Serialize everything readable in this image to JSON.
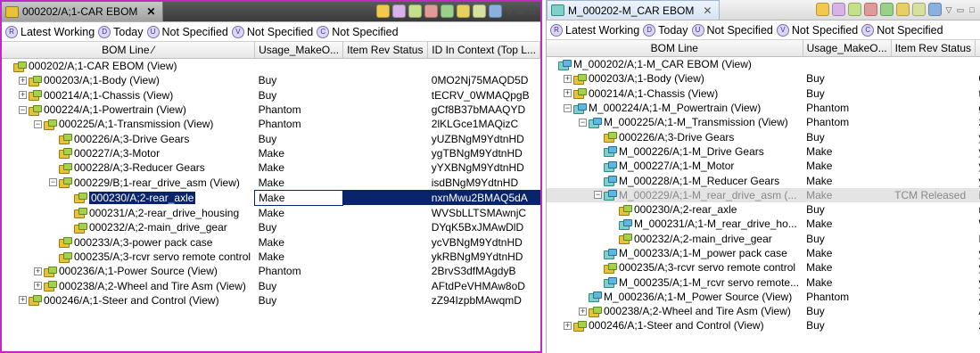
{
  "left": {
    "tab_title": "000202/A;1-CAR EBOM",
    "tab_close": "✕",
    "rev_rules": [
      "Latest Working",
      "Today",
      "Not Specified",
      "Not Specified",
      "Not Specified"
    ],
    "columns": [
      "BOM Line  ⁄",
      "Usage_MakeO...",
      "Item Rev Status",
      "ID In Context (Top L..."
    ],
    "rows": [
      {
        "indent": 0,
        "exp": "",
        "label": "000202/A;1-CAR EBOM (View)",
        "usage": "",
        "status": "",
        "id": ""
      },
      {
        "indent": 1,
        "exp": "+",
        "label": "000203/A;1-Body (View)",
        "usage": "Buy",
        "status": "",
        "id": "0MO2Nj75MAQD5D"
      },
      {
        "indent": 1,
        "exp": "+",
        "label": "000214/A;1-Chassis (View)",
        "usage": "Buy",
        "status": "",
        "id": "tECRV_0WMAQpgB"
      },
      {
        "indent": 1,
        "exp": "−",
        "label": "000224/A;1-Powertrain (View)",
        "usage": "Phantom",
        "status": "",
        "id": "gCf8B37bMAAQYD"
      },
      {
        "indent": 2,
        "exp": "−",
        "label": "000225/A;1-Transmission (View)",
        "usage": "Phantom",
        "status": "",
        "id": "2lKLGce1MAQizC"
      },
      {
        "indent": 3,
        "exp": "",
        "label": "000226/A;3-Drive Gears",
        "usage": "Buy",
        "status": "",
        "id": "yUZBNgM9YdtnHD"
      },
      {
        "indent": 3,
        "exp": "",
        "label": "000227/A;3-Motor",
        "usage": "Make",
        "status": "",
        "id": "ygTBNgM9YdtnHD"
      },
      {
        "indent": 3,
        "exp": "",
        "label": "000228/A;3-Reducer Gears",
        "usage": "Make",
        "status": "",
        "id": "yYXBNgM9YdtnHD"
      },
      {
        "indent": 3,
        "exp": "−",
        "label": "000229/B;1-rear_drive_asm (View)",
        "usage": "Make",
        "status": "",
        "id": "isdBNgM9YdtnHD"
      },
      {
        "indent": 4,
        "exp": "",
        "label": "000230/A;2-rear_axle",
        "usage": "Make",
        "status": "",
        "id": "nxnMwu2BMAQ5dA",
        "sel": true
      },
      {
        "indent": 4,
        "exp": "",
        "label": "000231/A;2-rear_drive_housing",
        "usage": "Make",
        "status": "",
        "id": "WVSbLLTSMAwnjC"
      },
      {
        "indent": 4,
        "exp": "",
        "label": "000232/A;2-main_drive_gear",
        "usage": "Buy",
        "status": "",
        "id": "DYqK5BxJMAwDlD"
      },
      {
        "indent": 3,
        "exp": "",
        "label": "000233/A;3-power pack case",
        "usage": "Make",
        "status": "",
        "id": "ycVBNgM9YdtnHD"
      },
      {
        "indent": 3,
        "exp": "",
        "label": "000235/A;3-rcvr servo remote control",
        "usage": "Make",
        "status": "",
        "id": "ykRBNgM9YdtnHD"
      },
      {
        "indent": 2,
        "exp": "+",
        "label": "000236/A;1-Power Source (View)",
        "usage": "Phantom",
        "status": "",
        "id": "2BrvS3dfMAgdyB"
      },
      {
        "indent": 2,
        "exp": "+",
        "label": "000238/A;2-Wheel and Tire Asm (View)",
        "usage": "Buy",
        "status": "",
        "id": "AFtdPeVHMAw8oD"
      },
      {
        "indent": 1,
        "exp": "+",
        "label": "000246/A;1-Steer and Control (View)",
        "usage": "Buy",
        "status": "",
        "id": "zZ94IzpbMAwqmD"
      }
    ]
  },
  "right": {
    "tab_title": "M_000202-M_CAR EBOM",
    "tab_close": "✕",
    "rev_rules": [
      "Latest Working",
      "Today",
      "Not Specified",
      "Not Specified",
      "Not Specified"
    ],
    "columns": [
      "BOM Line",
      "Usage_MakeO...",
      "Item Rev Status",
      "ID"
    ],
    "rows": [
      {
        "indent": 0,
        "exp": "",
        "label": "M_000202/A;1-M_CAR EBOM (View)",
        "usage": "",
        "status": "",
        "id": "",
        "teal": true
      },
      {
        "indent": 1,
        "exp": "+",
        "label": "000203/A;1-Body (View)",
        "usage": "Buy",
        "status": "",
        "id": "0M"
      },
      {
        "indent": 1,
        "exp": "+",
        "label": "000214/A;1-Chassis (View)",
        "usage": "Buy",
        "status": "",
        "id": "tE"
      },
      {
        "indent": 1,
        "exp": "−",
        "label": "M_000224/A;1-M_Powertrain (View)",
        "usage": "Phantom",
        "status": "",
        "id": "gC",
        "teal": true
      },
      {
        "indent": 2,
        "exp": "−",
        "label": "M_000225/A;1-M_Transmission (View)",
        "usage": "Phantom",
        "status": "",
        "id": "2l",
        "teal": true
      },
      {
        "indent": 3,
        "exp": "",
        "label": "000226/A;3-Drive Gears",
        "usage": "Buy",
        "status": "",
        "id": "yU"
      },
      {
        "indent": 3,
        "exp": "",
        "label": "M_000226/A;1-M_Drive Gears",
        "usage": "Make",
        "status": "",
        "id": "yU",
        "teal": true
      },
      {
        "indent": 3,
        "exp": "",
        "label": "M_000227/A;1-M_Motor",
        "usage": "Make",
        "status": "",
        "id": "yg",
        "teal": true
      },
      {
        "indent": 3,
        "exp": "",
        "label": "M_000228/A;1-M_Reducer Gears",
        "usage": "Make",
        "status": "",
        "id": "yY",
        "teal": true
      },
      {
        "indent": 3,
        "exp": "−",
        "label": "M_000229/A;1-M_rear_drive_asm (...",
        "usage": "Make",
        "status": "TCM Released",
        "id": "is",
        "teal": true,
        "grey": true
      },
      {
        "indent": 4,
        "exp": "",
        "label": "000230/A;2-rear_axle",
        "usage": "Buy",
        "status": "",
        "id": "nx"
      },
      {
        "indent": 4,
        "exp": "",
        "label": "M_000231/A;1-M_rear_drive_ho...",
        "usage": "Make",
        "status": "",
        "id": "W",
        "teal": true
      },
      {
        "indent": 4,
        "exp": "",
        "label": "000232/A;2-main_drive_gear",
        "usage": "Buy",
        "status": "",
        "id": "DY"
      },
      {
        "indent": 3,
        "exp": "",
        "label": "M_000233/A;1-M_power pack case",
        "usage": "Make",
        "status": "",
        "id": "yc",
        "teal": true
      },
      {
        "indent": 3,
        "exp": "",
        "label": "000235/A;3-rcvr servo remote control",
        "usage": "Make",
        "status": "",
        "id": "yk"
      },
      {
        "indent": 3,
        "exp": "",
        "label": "M_000235/A;1-M_rcvr servo remote...",
        "usage": "Make",
        "status": "",
        "id": "yk",
        "teal": true
      },
      {
        "indent": 2,
        "exp": "",
        "label": "M_000236/A;1-M_Power Source (View)",
        "usage": "Phantom",
        "status": "",
        "id": "2E",
        "teal": true
      },
      {
        "indent": 2,
        "exp": "+",
        "label": "000238/A;2-Wheel and Tire Asm (View)",
        "usage": "Buy",
        "status": "",
        "id": "Af"
      },
      {
        "indent": 1,
        "exp": "+",
        "label": "000246/A;1-Steer and Control (View)",
        "usage": "Buy",
        "status": "",
        "id": "zZ"
      }
    ]
  },
  "toolbar_icons": [
    "paste-icon",
    "refresh-icon",
    "compare-icon",
    "structure-icon",
    "expand-icon",
    "accept-icon",
    "filter-icon",
    "tree-icon",
    "view-menu-icon",
    "minimize-icon",
    "maximize-icon"
  ],
  "colors": {
    "active_tab_border": "#c02ac0",
    "selection": "#0a246a",
    "grey_row": "#e4e4e4"
  }
}
